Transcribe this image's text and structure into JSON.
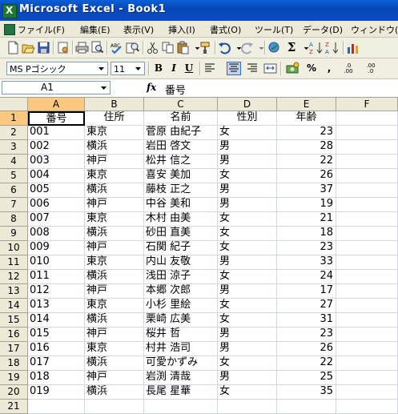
{
  "window": {
    "title": "Microsoft Excel - Book1"
  },
  "menu": [
    "ファイル(F)",
    "編集(E)",
    "表示(V)",
    "挿入(I)",
    "書式(O)",
    "ツール(T)",
    "データ(D)",
    "ウィンドウ(W)"
  ],
  "toolbar": {
    "standard_icons": [
      "new-icon",
      "open-icon",
      "save-icon",
      "permission-icon",
      "print-icon",
      "print-preview-icon",
      "spelling-icon",
      "research-icon",
      "cut-icon",
      "copy-icon",
      "paste-icon",
      "format-painter-icon",
      "undo-icon",
      "redo-icon",
      "hyperlink-icon",
      "autosum-icon",
      "sort-ascending-icon",
      "chart-icon"
    ],
    "font_name": "MS Pゴシック",
    "font_size": "11",
    "bold": "B",
    "italic": "I",
    "underline": "U",
    "percent": "%",
    "comma": ",",
    "increase_decimal": ".0\n.00",
    "decrease_decimal": ".00\n.0"
  },
  "formula_bar": {
    "name_box": "A1",
    "fx": "fx",
    "content": "番号"
  },
  "columns": [
    "A",
    "B",
    "C",
    "D",
    "E",
    "F"
  ],
  "rows": [
    "1",
    "2",
    "3",
    "4",
    "5",
    "6",
    "7",
    "8",
    "9",
    "10",
    "11",
    "12",
    "13",
    "14",
    "15",
    "16",
    "17",
    "18",
    "19",
    "20",
    "21"
  ],
  "headers": [
    "番号",
    "住所",
    "名前",
    "性別",
    "年齢"
  ],
  "records": [
    [
      "001",
      "東京",
      "菅原 由紀子",
      "女",
      "23"
    ],
    [
      "002",
      "横浜",
      "岩田 啓文",
      "男",
      "28"
    ],
    [
      "003",
      "神戸",
      "松井 信之",
      "男",
      "22"
    ],
    [
      "004",
      "東京",
      "喜安 美加",
      "女",
      "26"
    ],
    [
      "005",
      "横浜",
      "藤枝 正之",
      "男",
      "37"
    ],
    [
      "006",
      "神戸",
      "中谷 美和",
      "男",
      "19"
    ],
    [
      "007",
      "東京",
      "木村 由美",
      "女",
      "21"
    ],
    [
      "008",
      "横浜",
      "砂田 直美",
      "女",
      "18"
    ],
    [
      "009",
      "神戸",
      "石関 紀子",
      "女",
      "23"
    ],
    [
      "010",
      "東京",
      "内山 友敬",
      "男",
      "33"
    ],
    [
      "011",
      "横浜",
      "浅田 涼子",
      "女",
      "24"
    ],
    [
      "012",
      "神戸",
      "本郷 次郎",
      "男",
      "17"
    ],
    [
      "013",
      "東京",
      "小杉 里絵",
      "女",
      "27"
    ],
    [
      "014",
      "横浜",
      "栗崎 広美",
      "女",
      "31"
    ],
    [
      "015",
      "神戸",
      "桜井 哲",
      "男",
      "23"
    ],
    [
      "016",
      "東京",
      "村井 浩司",
      "男",
      "26"
    ],
    [
      "017",
      "横浜",
      "可愛かずみ",
      "女",
      "22"
    ],
    [
      "018",
      "神戸",
      "岩渕 清哉",
      "男",
      "25"
    ],
    [
      "019",
      "横浜",
      "長尾 星華",
      "女",
      "35"
    ]
  ],
  "selected_cell": "A1",
  "colors": {
    "title_bar": "#0a5fd8",
    "selection_header": "#fbc880",
    "chrome": "#ece9d8"
  }
}
